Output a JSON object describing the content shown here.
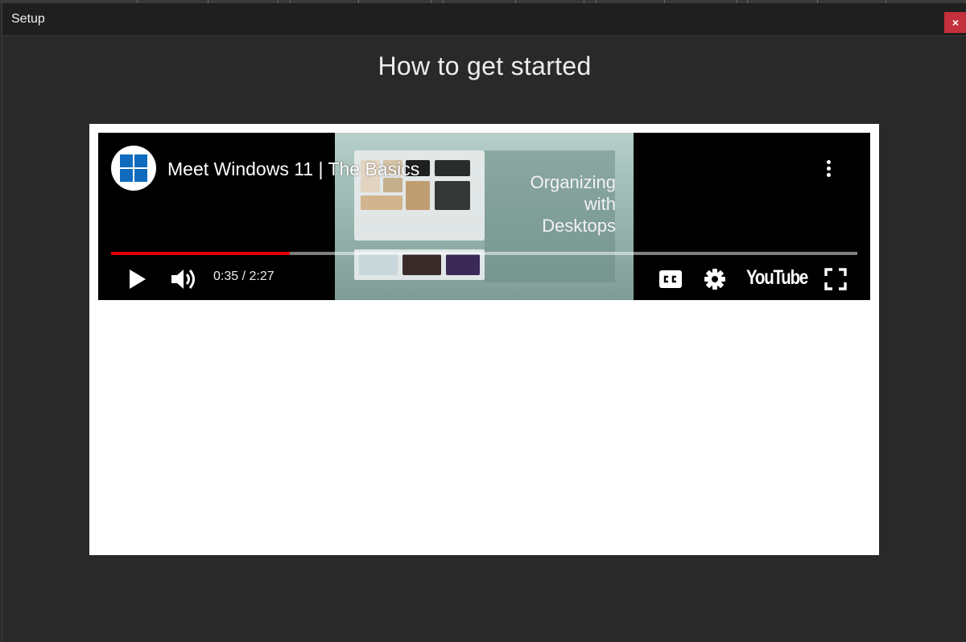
{
  "window": {
    "title": "Setup",
    "close_label": "×"
  },
  "heading": "How to get started",
  "video": {
    "title": "Meet Windows 11 | The Basics",
    "overlay_text": "Organizing\nwith\nDesktops",
    "time": "0:35 / 2:27",
    "progress": 0.24,
    "brand": "YouTube",
    "colors": {
      "progress": "#e00000",
      "windows_blue": "#0f6cbd"
    }
  },
  "icons": {
    "channel": "windows-logo-icon",
    "more": "vertical-ellipsis-icon",
    "play": "play-icon",
    "volume": "volume-icon",
    "captions": "closed-captions-icon",
    "settings": "gear-icon",
    "fullscreen": "fullscreen-icon"
  }
}
